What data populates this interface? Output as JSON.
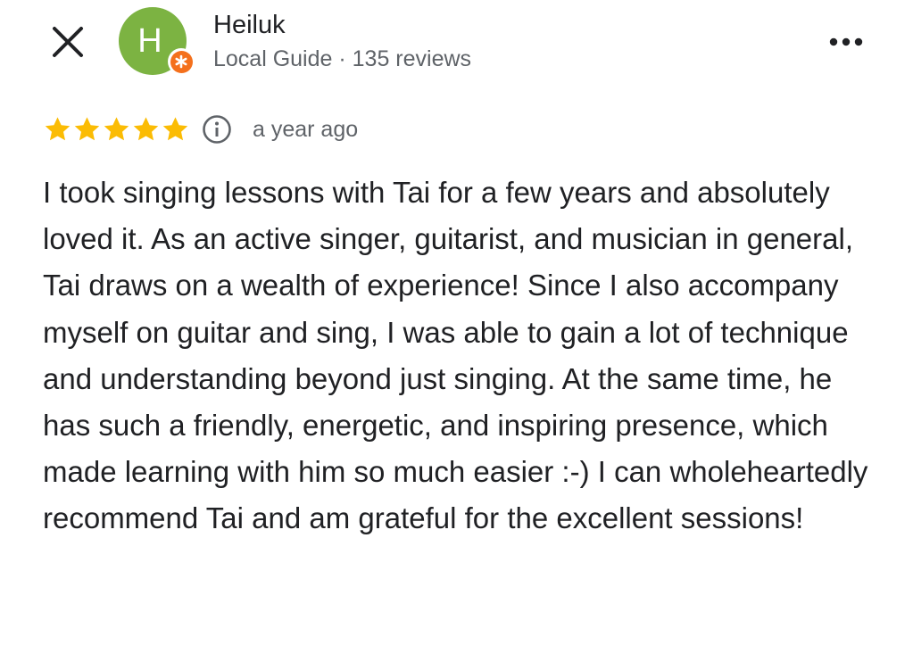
{
  "header": {
    "close_label": "Close",
    "avatar_initial": "H",
    "reviewer_name": "Heiluk",
    "reviewer_meta": "Local Guide · 135 reviews",
    "more_label": "More options"
  },
  "review": {
    "rating": 5,
    "rating_max": 5,
    "date": "a year ago",
    "text": "I took singing lessons with Tai for a few years and absolutely loved it. As an active singer, guitarist, and musician in general, Tai draws on a wealth of experience! Since I also accompany myself on guitar and sing, I was able to gain a lot of technique and understanding beyond just singing. At the same time, he has such a friendly, energetic, and inspiring presence, which made learning with him so much easier :-) I can wholeheartedly recommend Tai and am grateful for the excellent sessions!"
  },
  "colors": {
    "avatar_bg": "#7cb342",
    "local_guide_badge": "#f4701c",
    "star_fill": "#fbbc04",
    "text_primary": "#202124",
    "text_secondary": "#5f6368"
  },
  "icons": {
    "close": "close-icon",
    "more": "more-horiz-icon",
    "badge": "local-guide-badge-icon",
    "star": "star-icon",
    "info": "info-icon"
  }
}
